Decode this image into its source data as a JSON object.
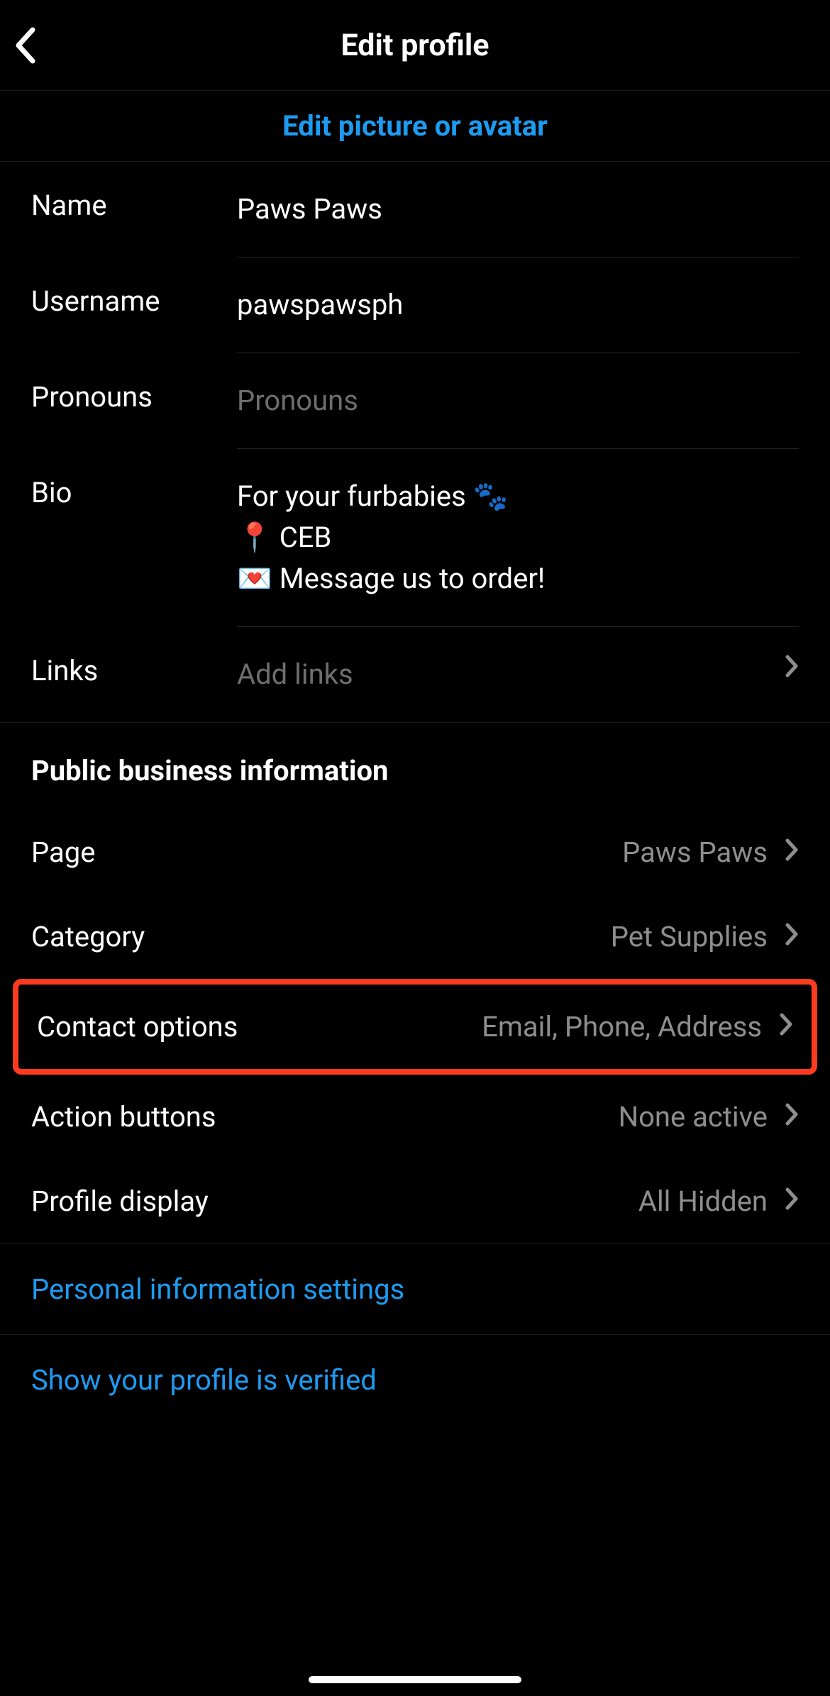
{
  "header": {
    "title": "Edit profile"
  },
  "editPictureLabel": "Edit picture or avatar",
  "form": {
    "name": {
      "label": "Name",
      "value": "Paws Paws"
    },
    "username": {
      "label": "Username",
      "value": "pawspawsph"
    },
    "pronouns": {
      "label": "Pronouns",
      "placeholder": "Pronouns"
    },
    "bio": {
      "label": "Bio",
      "value": "For your furbabies 🐾\n📍 CEB\n💌 Message us to order!"
    },
    "links": {
      "label": "Links",
      "placeholder": "Add links"
    }
  },
  "businessHeading": "Public business information",
  "business": {
    "page": {
      "label": "Page",
      "value": "Paws Paws"
    },
    "category": {
      "label": "Category",
      "value": "Pet Supplies"
    },
    "contact": {
      "label": "Contact options",
      "value": "Email, Phone, Address"
    },
    "actionButtons": {
      "label": "Action buttons",
      "value": "None active"
    },
    "profileDisplay": {
      "label": "Profile display",
      "value": "All Hidden"
    }
  },
  "links": {
    "personalInfo": "Personal information settings",
    "verified": "Show your profile is verified"
  }
}
